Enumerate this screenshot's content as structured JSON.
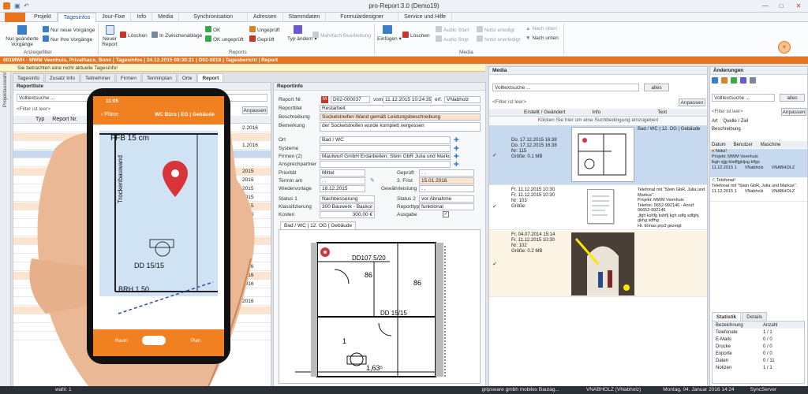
{
  "window": {
    "title": "pro-Report 3.0 (Demo19)"
  },
  "menu": [
    "Projekt",
    "Tagesinfos",
    "Jour-Fixe",
    "Info",
    "Media",
    "Synchronisation",
    "Adressen",
    "Stammdaten",
    "Formulardesigner",
    "Service und Hilfe"
  ],
  "ribbon": {
    "filter_btn": "Nur geänderte Vorgänge",
    "new_items": "Nur neue Vorgänge",
    "my_items": "Nur Ihre Vorgänge",
    "group_filter": "Anzeigefilter",
    "new_report": "Neuer Report",
    "delete": "Löschen",
    "clipboard": "In Zwischenablage",
    "ok": "OK",
    "ok_unchecked": "OK ungeprüft",
    "unchecked": "Ungeprüft",
    "checked": "Geprüft",
    "type_change": "Typ ändern",
    "multi_edit": "Mehrfach Bearbeitung",
    "group_reports": "Reports",
    "insert": "Einfügen",
    "delete2": "Löschen",
    "audio_start": "Audio Start",
    "audio_stop": "Audio Stop",
    "note_done": "Notiz erledigt",
    "note_open": "Notiz unerledigt",
    "move_up": "Nach oben",
    "move_down": "Nach unten",
    "group_media": "Media"
  },
  "breadcrumb": "001MWH - MWM Veenhuis, Privathaus, Bonn  |  Tagesinfos  |  24.12.2015 09:30:21  |  D02-0018  |  Tagesbericht  |  Report",
  "warning": "Sie betrachten eine nicht aktuelle Tagesinfo!",
  "side_label": "Projektauswahl",
  "tabs": [
    "Tagesinfo",
    "Zusatz Info",
    "Teilnehmer",
    "Firmen",
    "Terminplan",
    "Orte",
    "Report"
  ],
  "reportlist": {
    "title": "Reportliste",
    "search": "Volltextsuche ...",
    "filter": "<Filter ist leer>",
    "clear": "Anpassen",
    "col_typ": "Typ",
    "col_report": "Report Nr.",
    "dates": [
      "2.2016",
      "",
      "1.2016",
      "",
      "",
      "2015",
      "2015",
      "2015",
      "2015",
      "2015",
      "2015",
      "2015",
      "2015",
      "2015",
      "2016",
      "",
      "2016",
      "2016",
      "2016",
      "",
      "2016",
      "",
      "",
      "",
      ""
    ]
  },
  "phone": {
    "time": "11:05",
    "back": "Pläne",
    "location": "WC Büro | EG | Gebäude",
    "room": "FFB 15 cm",
    "wall": "Trockenbauwand",
    "dd": "DD 15/15",
    "brh": "BRH 1.50",
    "left_tab": "Raum",
    "right_tab": "Plan"
  },
  "reportinfo": {
    "title": "Reportinfo",
    "report_no_label": "Report Nr.",
    "report_no": "D02-000037",
    "from_label": "vom",
    "from": "11.12.2015 10:24:39",
    "by_label": "erf.",
    "by": "VNabholz",
    "title_label": "Reporttitel",
    "title_val": "Restarbeit",
    "desc_label": "Beschreibung",
    "desc": "Sockelstreifen Wand gemäß Leistungsbeschreibung",
    "note_label": "Bemerkung",
    "note": "der Sockelstreifen wurde komplett vergessen",
    "place_label": "Ort",
    "place": "Bad / WC",
    "systems_label": "Systeme",
    "firms_label": "Firmen (2)",
    "firms": "Maulwurf GmbH Erdarbeiten; Stein GbR Julia und Markus",
    "contact_label": "Ansprechpartner",
    "prio_label": "Priorität",
    "prio": "Mittel",
    "checked_label": "Geprüft",
    "checked": ". .",
    "date_label": "Termin am",
    "date": ". .",
    "deadline_label": "3. Frist",
    "deadline": "15.01.2016",
    "resub_label": "Wiedervorlage",
    "resub": "18.12.2015",
    "warranty_label": "Gewährleistung",
    ". .": ". .",
    "warranty": ". .",
    "status1_label": "Status 1",
    "status1": "Nachbesserung",
    "status2_label": "Status 2",
    "status2": "vor Abnahme",
    "class_label": "Klassifizierung",
    "class": "300 Bauwerk - Baukor",
    "rtype_label": "Reporttyp",
    "rtype": "funktional",
    "cost_label": "Kosten",
    "cost": "300,00 €",
    "expense_label": "Ausgabe"
  },
  "plan": {
    "tab": "Bad / WC | 12. OG | Gebäude",
    "dd107": "DD107.5/20",
    "n86a": "86",
    "n86b": "86",
    "dd15": "DD 15/15",
    "n1": "1",
    "dim": "1,63⁵"
  },
  "media": {
    "title": "Media",
    "search": "Volltextsuche ...",
    "all": "alles",
    "filter": "<Filter ist leer>",
    "adjust": "Anpassen",
    "col_created": "Erstellt / Geändert",
    "col_info": "Info",
    "col_text": "Text",
    "hint": "Klicken Sie hier um eine Suchbedingung einzugeben",
    "items": [
      {
        "line1": "Do. 17.12.2015 16:38",
        "line2": "Do. 17.12.2015 16:38",
        "line3": "Nr: 115",
        "line4": "Größe: 0.1 MB",
        "text": "Bad / WC | 12. OG | Gebäude"
      },
      {
        "line1": "Fr. 11.12.2015 10:30",
        "line2": "Fr. 11.12.2015 10:30",
        "line3": "Nr: 103",
        "line4": "Größe:",
        "text": "Telefonat mit \"Stein GbR, Julia und Markus\".\nProjekt: MWM Veenhuis\nTelefon: 0652-992146 - Anruf: 06652-992146\n,jfgh kshfg kshflj kgh sdfg sdfghj gkhg sdfhg\nHr. Elmas prp3 gezeigt"
      },
      {
        "line1": "Fr. 04.07.2014 15:14",
        "line2": "Fr. 11.12.2015 10:30",
        "line3": "Nr: 102",
        "line4": "Größe: 0.2 MB",
        "text": ""
      }
    ]
  },
  "changes": {
    "title": "Änderungen",
    "search": "Volltextsuche ...",
    "all": "alles",
    "filter": "<Filter ist leer>",
    "adjust": "Anpassen",
    "col_art": "Art",
    "col_source": "Quelle / Ziel",
    "col_desc": "Beschreibung",
    "col_date": "Datum",
    "col_user": "Benutzer",
    "col_machine": "Maschine",
    "note_label": "Notiz!",
    "note1": "Projekt: MWM Veenhuis",
    "note2": "lkgh sjjg klsdfjgkljsg klfgs",
    "row1_date": "11.12.2015 1",
    "row1_user": "VNabholz",
    "row1_machine": "VNABHOLZ",
    "call_label": "Telefonat!",
    "call_text": "Telefonat mit \"Stein GbR, Julia und Markus\".",
    "row2_date": "11.12.2015 1",
    "row2_user": "VNabholz",
    "row2_machine": "VNABHOLZ",
    "stats_tab": "Statistik",
    "details_tab": "Details",
    "stats_col1": "Bezeichnung",
    "stats_col2": "Anzahl",
    "stats": [
      {
        "name": "Telefonate",
        "count": "1 / 1"
      },
      {
        "name": "E-Mails",
        "count": "0 / 0"
      },
      {
        "name": "Drucke",
        "count": "0 / 0"
      },
      {
        "name": "Exporte",
        "count": "0 / 0"
      },
      {
        "name": "Daten",
        "count": "0 / 11"
      },
      {
        "name": "Notizen",
        "count": "1 / 1"
      }
    ]
  },
  "status": {
    "left": "wahl: 1",
    "company": "gripsware gmbh mobiles Bautag...",
    "user": "VNABHOLZ (VNabholz)",
    "date": "Montag, 04. Januar 2016 14:24",
    "sync": "SyncServer"
  },
  "colors": {
    "accent": "#e8741e",
    "selection": "#c6d9ef"
  }
}
